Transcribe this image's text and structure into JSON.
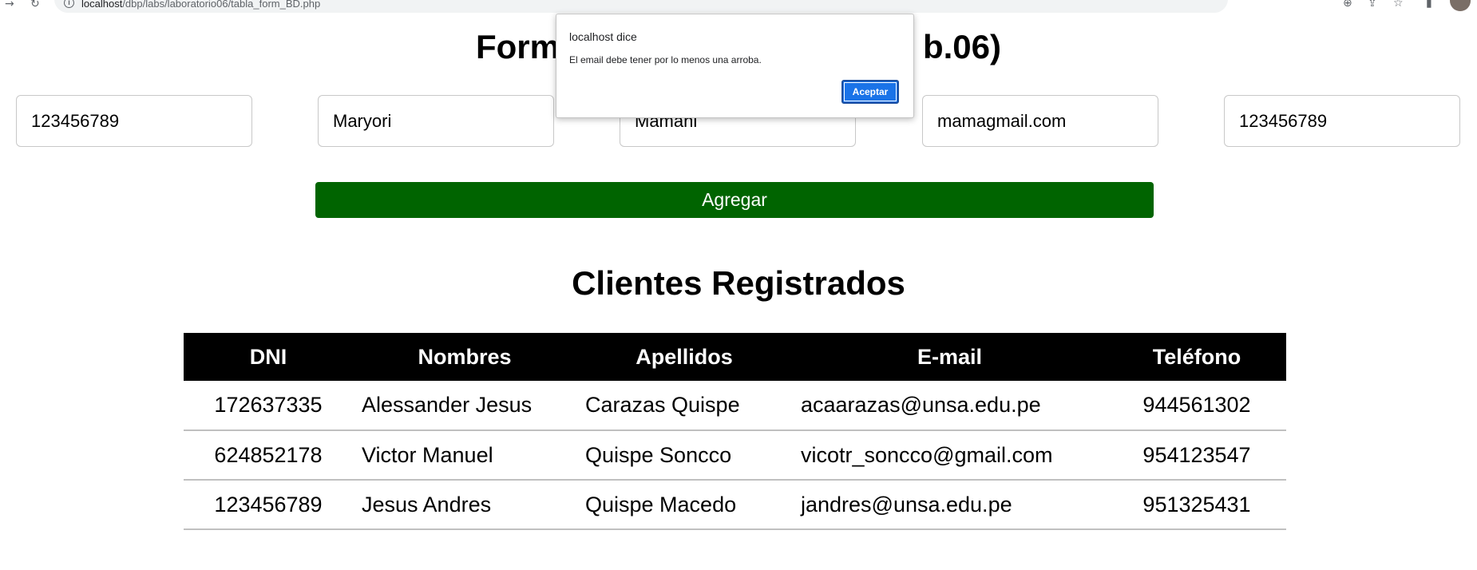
{
  "browser": {
    "url_host": "localhost",
    "url_path": "/dbp/labs/laboratorio06/tabla_form_BD.php"
  },
  "page": {
    "title_left": "Form",
    "title_right": "b.06)"
  },
  "form": {
    "dni_value": "123456789",
    "nombres_value": "Maryori",
    "apellidos_value": "Mamani",
    "email_value": "mamagmail.com",
    "telefono_value": "123456789",
    "submit_label": "Agregar"
  },
  "clients": {
    "title": "Clientes Registrados",
    "headers": [
      "DNI",
      "Nombres",
      "Apellidos",
      "E-mail",
      "Teléfono"
    ],
    "rows": [
      [
        "172637335",
        "Alessander Jesus",
        "Carazas Quispe",
        "acaarazas@unsa.edu.pe",
        "944561302"
      ],
      [
        "624852178",
        "Victor Manuel",
        "Quispe Soncco",
        "vicotr_soncco@gmail.com",
        "954123547"
      ],
      [
        "123456789",
        "Jesus Andres",
        "Quispe Macedo",
        "jandres@unsa.edu.pe",
        "951325431"
      ]
    ]
  },
  "alert": {
    "title": "localhost dice",
    "message": "El email debe tener por lo menos una arroba.",
    "ok_label": "Aceptar",
    "ok_color": "#1a73e8"
  },
  "colors": {
    "submit_bg": "#006400",
    "table_header_bg": "#000000"
  }
}
